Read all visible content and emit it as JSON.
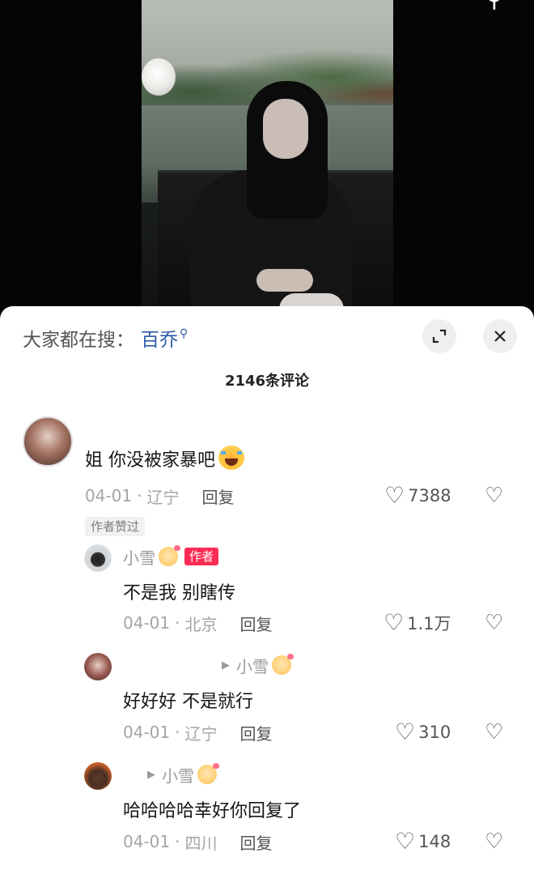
{
  "header": {
    "search_prefix": "大家都在搜：",
    "search_keyword": "百乔",
    "keyword_icon": "search-icon",
    "expand_icon": "expand-icon",
    "close_icon": "close-icon",
    "comment_count": "2146条评论"
  },
  "comments": [
    {
      "text": "姐 你没被家暴吧",
      "emoji": "loudly-crying-face-emoji",
      "date": "04-01",
      "location": "辽宁",
      "reply_label": "回复",
      "likes": "7388",
      "author_liked": "作者赞过"
    },
    {
      "user": "小雪",
      "badge": "作者",
      "text": "不是我 别瞎传",
      "date": "04-01",
      "location": "北京",
      "reply_label": "回复",
      "likes": "1.1万"
    },
    {
      "reply_to": "小雪",
      "text": "好好好 不是就行",
      "date": "04-01",
      "location": "辽宁",
      "reply_label": "回复",
      "likes": "310"
    },
    {
      "reply_to": "小雪",
      "text": "哈哈哈哈幸好你回复了",
      "date": "04-01",
      "location": "四川",
      "reply_label": "回复",
      "likes": "148"
    }
  ],
  "separator": "·",
  "colors": {
    "accent": "#fe2c55",
    "keyword": "#2b5aa6",
    "sheet_bg": "#ffffff"
  }
}
